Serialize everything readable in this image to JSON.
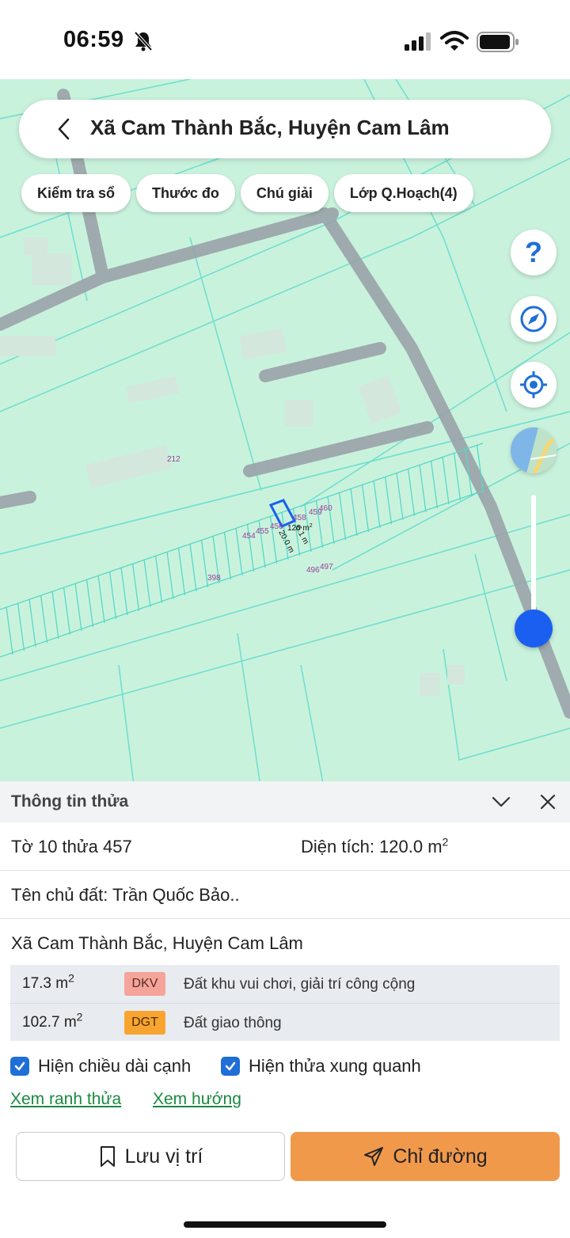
{
  "status_bar": {
    "time": "06:59"
  },
  "search": {
    "title": "Xã Cam Thành Bắc, Huyện Cam Lâm"
  },
  "chips": [
    "Kiểm tra sổ",
    "Thước đo",
    "Chú giải",
    "Lớp Q.Hoạch(4)"
  ],
  "map": {
    "parcel_labels": [
      "212",
      "398",
      "454",
      "455",
      "456",
      "458",
      "459",
      "460",
      "496",
      "497"
    ],
    "area_label": "120 m",
    "length_label_1": "20.0 m",
    "length_label_2": "6.1 m"
  },
  "sheet": {
    "title": "Thông tin thửa",
    "parcel_id": "Tờ 10 thửa 457",
    "area_label": "Diện tích: 120.0 m",
    "owner": "Tên chủ đất: Trần Quốc Bảo..",
    "address": "Xã Cam Thành Bắc, Huyện Cam Lâm",
    "land_use": [
      {
        "area": "17.3 m",
        "code": "DKV",
        "desc": "Đất khu vui chơi, giải trí công cộng",
        "color": "#f4a49a"
      },
      {
        "area": "102.7 m",
        "code": "DGT",
        "desc": "Đất giao thông",
        "color": "#f7a530"
      }
    ],
    "check_edge_length": "Hiện chiều dài cạnh",
    "check_neighbors": "Hiện thửa xung quanh",
    "link_boundary": "Xem ranh thửa",
    "link_direction": "Xem hướng",
    "save_label": "Lưu vị trí",
    "directions_label": "Chỉ đường"
  },
  "colors": {
    "accent_blue": "#1f6fd6",
    "map_bg": "#c9f2dd",
    "directions_btn": "#f1994b",
    "link": "#1a8a40"
  }
}
